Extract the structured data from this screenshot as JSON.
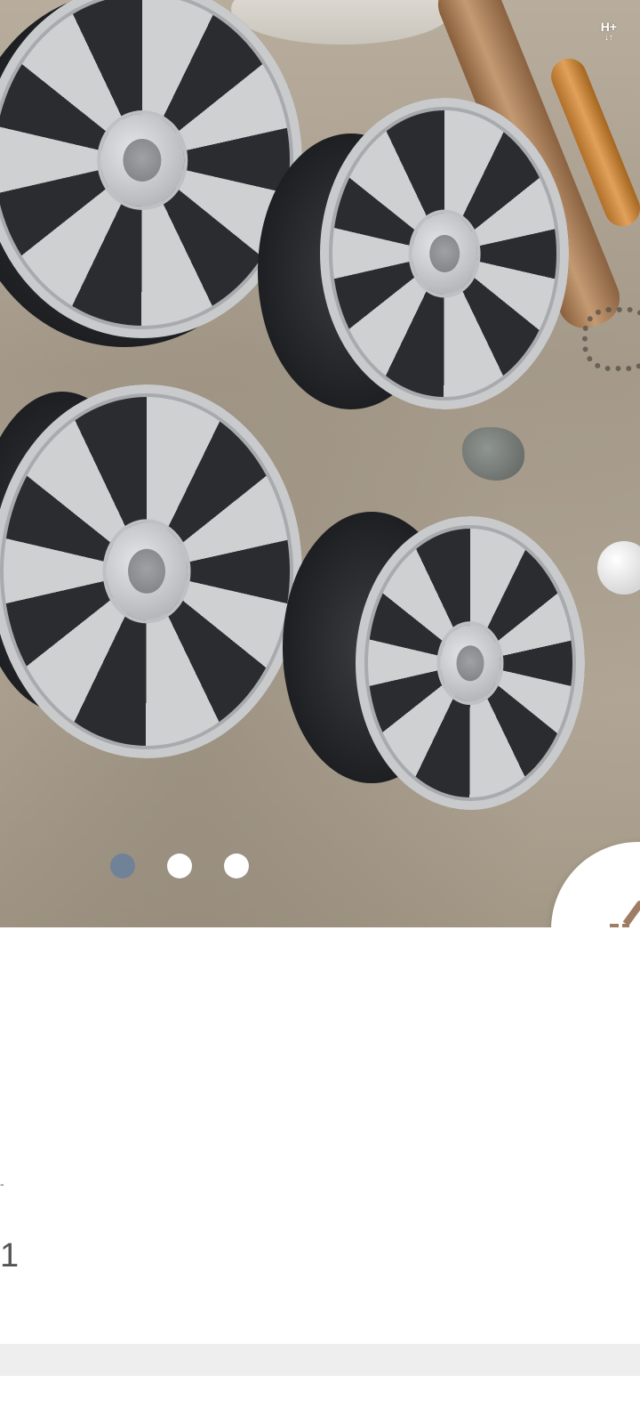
{
  "status_bar": {
    "network_label": "H+",
    "network_arrows": "↓↑"
  },
  "carousel": {
    "image_count": 3,
    "active_index": 0,
    "active_dot_color": "#6f8297",
    "inactive_dot_color": "#ffffff"
  },
  "fab": {
    "icon": "share-icon"
  },
  "details": {
    "partial_mark": "-",
    "partial_value": "1"
  }
}
